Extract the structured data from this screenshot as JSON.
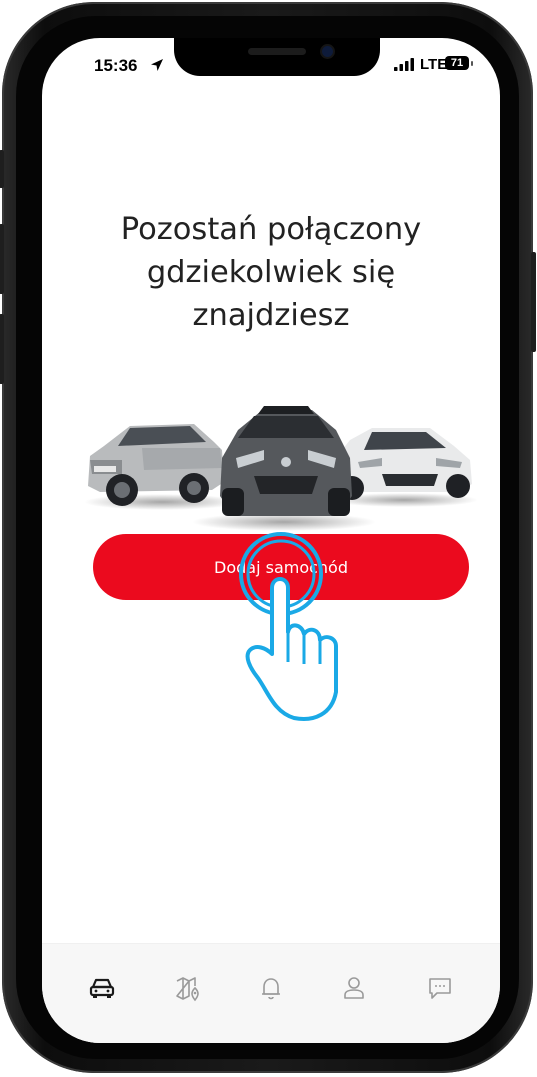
{
  "status_bar": {
    "time": "15:36",
    "network": "LTE",
    "battery": "71"
  },
  "onboarding": {
    "headline_line1": "Pozostań połączony",
    "headline_line2": "gdziekolwiek się",
    "headline_line3": "znajdziesz",
    "cta_label": "Dodaj samochód"
  },
  "tab_bar": {
    "tabs": [
      {
        "icon": "car-icon",
        "active": true
      },
      {
        "icon": "map-icon",
        "active": false
      },
      {
        "icon": "bell-icon",
        "active": false
      },
      {
        "icon": "user-icon",
        "active": false
      },
      {
        "icon": "chat-icon",
        "active": false
      }
    ]
  },
  "colors": {
    "accent": "#eb0a1e",
    "tap_highlight": "#1aa9e6",
    "icon_inactive": "#9a9a9a",
    "icon_active": "#1a1a1a"
  }
}
